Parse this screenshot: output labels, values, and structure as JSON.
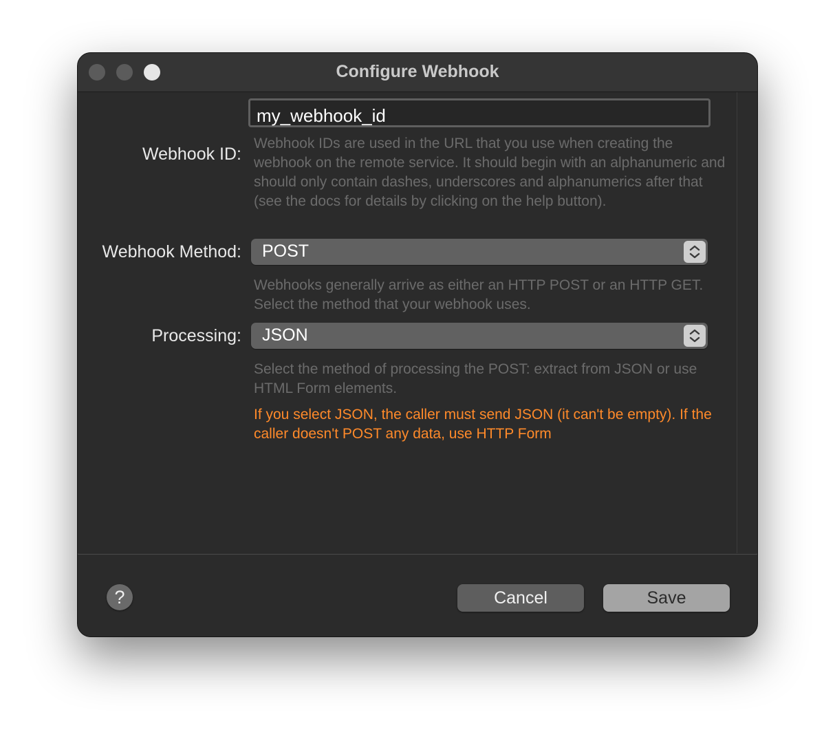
{
  "window": {
    "title": "Configure Webhook"
  },
  "webhook_id": {
    "label": "Webhook ID:",
    "value": "my_webhook_id",
    "help": "Webhook IDs are used in the URL that you use when creating the webhook on the remote service. It should begin with an alphanumeric and should only contain dashes, underscores and alphanumerics after that (see the docs for details by clicking on the help button)."
  },
  "webhook_method": {
    "label": "Webhook Method:",
    "selected": "POST",
    "help": "Webhooks generally arrive as either an HTTP POST or an HTTP GET. Select the method that your webhook uses."
  },
  "processing": {
    "label": "Processing:",
    "selected": "JSON",
    "help": "Select the method of processing the POST: extract from JSON or use HTML Form elements.",
    "warning": "If you select JSON, the caller must send JSON (it can't be empty). If the caller doesn't POST any data, use HTTP Form"
  },
  "footer": {
    "help_label": "?",
    "cancel_label": "Cancel",
    "save_label": "Save"
  },
  "colors": {
    "warning": "#ff8a2a",
    "window_bg": "#2b2b2b",
    "helptext": "#6b6b6b"
  }
}
